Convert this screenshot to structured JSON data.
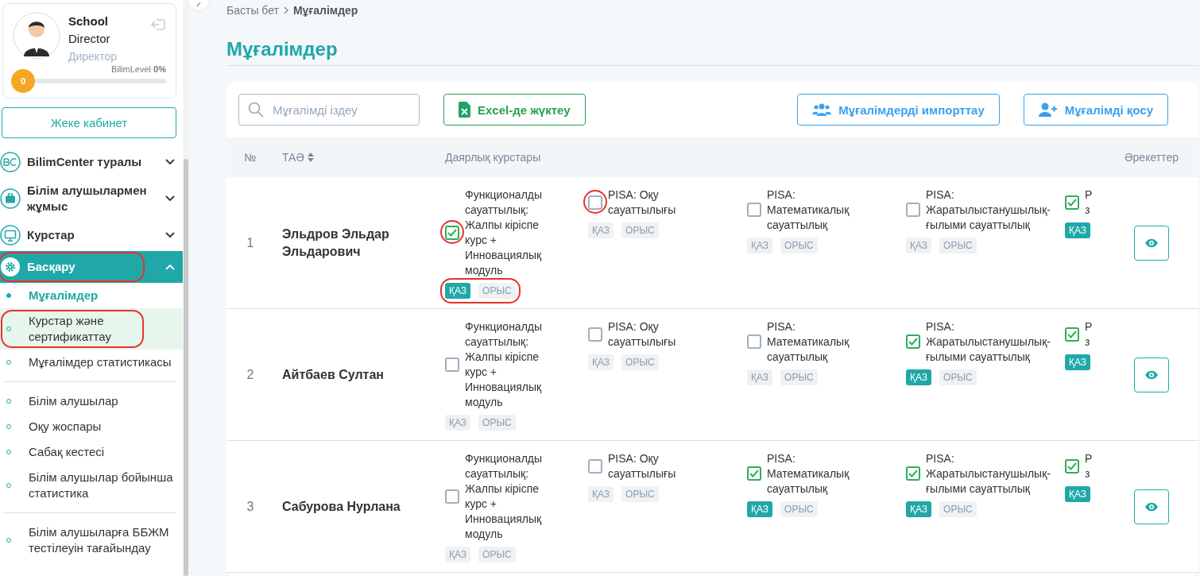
{
  "profile": {
    "name_line1": "School",
    "name_line2": "Director",
    "role": "Директор",
    "level_label": "BilimLevel",
    "level_percent": "0%",
    "level_badge": "0",
    "level": 0
  },
  "cabinet_button": "Жеке кабинет",
  "nav": [
    {
      "label": "BilimCenter туралы",
      "expanded": false,
      "selected": false,
      "circled": false
    },
    {
      "label": "Білім алушылармен жұмыс",
      "expanded": false,
      "selected": false,
      "circled": false
    },
    {
      "label": "Курстар",
      "expanded": false,
      "selected": false,
      "circled": false
    },
    {
      "label": "Басқару",
      "expanded": true,
      "selected": true,
      "circled": true
    }
  ],
  "subnav_groups": [
    [
      {
        "label": "Мұғалімдер",
        "selected": true,
        "hovered": false,
        "circled": false
      },
      {
        "label": "Курстар және сертификаттау",
        "selected": false,
        "hovered": true,
        "circled": true
      },
      {
        "label": "Мұғалімдер статистикасы",
        "selected": false,
        "hovered": false,
        "circled": false
      }
    ],
    [
      {
        "label": "Білім алушылар",
        "selected": false,
        "hovered": false,
        "circled": false
      },
      {
        "label": "Оқу жоспары",
        "selected": false,
        "hovered": false,
        "circled": false
      },
      {
        "label": "Сабақ кестесі",
        "selected": false,
        "hovered": false,
        "circled": false
      },
      {
        "label": "Білім алушылар бойынша статистика",
        "selected": false,
        "hovered": false,
        "circled": false
      }
    ],
    [
      {
        "label": "Білім алушыларға ББЖМ тестілеуін тағайындау",
        "selected": false,
        "hovered": false,
        "circled": false
      }
    ]
  ],
  "breadcrumb": [
    {
      "label": "Басты бет",
      "current": false
    },
    {
      "label": "Мұғалімдер",
      "current": true
    }
  ],
  "page_title": "Мұғалімдер",
  "search": {
    "placeholder": "Мұғалімді іздеу"
  },
  "buttons": [
    {
      "label": "Excel-де жүктеу",
      "kind": "excel"
    },
    {
      "label": "Мұғалімдерді импорттау",
      "kind": "import"
    },
    {
      "label": "Мұғалімді қосу",
      "kind": "add"
    }
  ],
  "table": {
    "columns": [
      "№",
      "ТАӘ",
      "Даярлық курстары",
      "Әрекеттер"
    ],
    "rows": [
      {
        "number": "1",
        "name": "Эльдров Эльдар Эльдарович",
        "courses": [
          {
            "title": "Функционалды сауаттылық: Жалпы кіріспе курс + Инновациялық модуль",
            "checked": true,
            "circled": true,
            "tags_circled": true,
            "tags": [
              {
                "label": "ҚАЗ",
                "selected": true
              },
              {
                "label": "ОРЫС",
                "selected": false
              }
            ]
          },
          {
            "title": "PISA: Оқу сауаттылығы",
            "checked": false,
            "circled": true,
            "tags": [
              {
                "label": "ҚАЗ",
                "selected": false
              },
              {
                "label": "ОРЫС",
                "selected": false
              }
            ]
          },
          {
            "title": "PISA: Математикалық сауаттылық",
            "checked": false,
            "tags": [
              {
                "label": "ҚАЗ",
                "selected": false
              },
              {
                "label": "ОРЫС",
                "selected": false
              }
            ]
          },
          {
            "title": "PISA: Жаратылыстанушылық-ғылыми сауаттылық",
            "checked": false,
            "tags": [
              {
                "label": "ҚАЗ",
                "selected": false
              },
              {
                "label": "ОРЫС",
                "selected": false
              }
            ]
          },
          {
            "title": "Р з",
            "checked": true,
            "tags": [
              {
                "label": "ҚАЗ",
                "selected": true
              }
            ]
          }
        ]
      },
      {
        "number": "2",
        "name": "Айтбаев Султан",
        "courses": [
          {
            "title": "Функционалды сауаттылық: Жалпы кіріспе курс + Инновациялық модуль",
            "checked": false,
            "tags": [
              {
                "label": "ҚАЗ",
                "selected": false
              },
              {
                "label": "ОРЫС",
                "selected": false
              }
            ]
          },
          {
            "title": "PISA: Оқу сауаттылығы",
            "checked": false,
            "tags": [
              {
                "label": "ҚАЗ",
                "selected": false
              },
              {
                "label": "ОРЫС",
                "selected": false
              }
            ]
          },
          {
            "title": "PISA: Математикалық сауаттылық",
            "checked": false,
            "tags": [
              {
                "label": "ҚАЗ",
                "selected": false
              },
              {
                "label": "ОРЫС",
                "selected": false
              }
            ]
          },
          {
            "title": "PISA: Жаратылыстанушылық-ғылыми сауаттылық",
            "checked": true,
            "tags": [
              {
                "label": "ҚАЗ",
                "selected": true
              },
              {
                "label": "ОРЫС",
                "selected": false
              }
            ]
          },
          {
            "title": "Р з",
            "checked": true,
            "tags": [
              {
                "label": "ҚАЗ",
                "selected": true
              }
            ]
          }
        ]
      },
      {
        "number": "3",
        "name": "Сабурова Нурлана",
        "courses": [
          {
            "title": "Функционалды сауаттылық: Жалпы кіріспе курс + Инновациялық модуль",
            "checked": false,
            "tags": [
              {
                "label": "ҚАЗ",
                "selected": false
              },
              {
                "label": "ОРЫС",
                "selected": false
              }
            ]
          },
          {
            "title": "PISA: Оқу сауаттылығы",
            "checked": false,
            "tags": [
              {
                "label": "ҚАЗ",
                "selected": false
              },
              {
                "label": "ОРЫС",
                "selected": false
              }
            ]
          },
          {
            "title": "PISA: Математикалық сауаттылық",
            "checked": true,
            "tags": [
              {
                "label": "ҚАЗ",
                "selected": true
              },
              {
                "label": "ОРЫС",
                "selected": false
              }
            ]
          },
          {
            "title": "PISA: Жаратылыстанушылық-ғылыми сауаттылық",
            "checked": true,
            "tags": [
              {
                "label": "ҚАЗ",
                "selected": true
              },
              {
                "label": "ОРЫС",
                "selected": false
              }
            ]
          },
          {
            "title": "Р з",
            "checked": true,
            "tags": [
              {
                "label": "ҚАЗ",
                "selected": true
              }
            ]
          }
        ]
      }
    ]
  }
}
